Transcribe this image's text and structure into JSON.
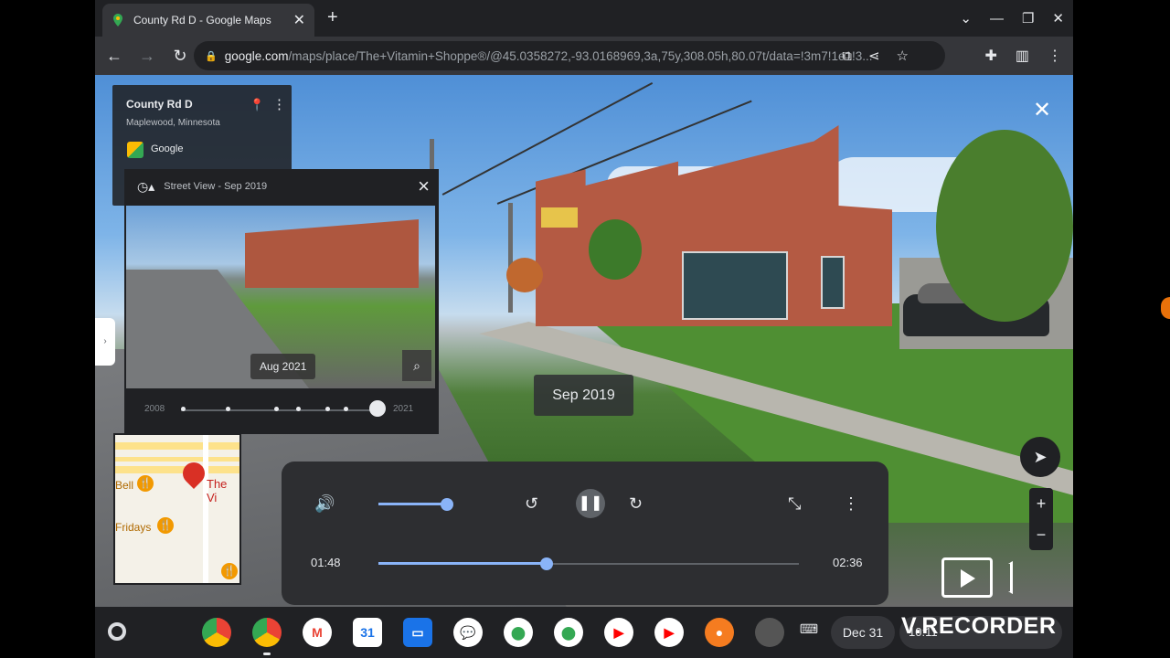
{
  "browser": {
    "tab_title": "County Rd D - Google Maps",
    "tab_close": "✕",
    "new_tab": "+",
    "url_host": "google.com",
    "url_rest": "/maps/place/The+Vitamin+Shoppe®/@45.0358272,-93.0168969,3a,75y,308.05h,80.07t/data=!3m7!1e1!3..."
  },
  "place_card": {
    "name": "County Rd D",
    "location": "Maplewood, Minnesota",
    "provider": "Google"
  },
  "time_travel": {
    "header": "Street View - Sep 2019",
    "date_label": "Aug 2021",
    "year_start": "2008",
    "year_end": "2021",
    "slider_position": 0.97
  },
  "streetview": {
    "current_date": "Sep 2019"
  },
  "minimap": {
    "place_label": "The Vi",
    "label_1": "Bell",
    "label_2": "Fridays"
  },
  "player": {
    "elapsed": "01:48",
    "duration": "02:36",
    "progress": 0.4,
    "volume": 0.66
  },
  "watermark": {
    "text": "V.RECORDER"
  },
  "shelf": {
    "date": "Dec 31",
    "time": "10:11"
  },
  "colors": {
    "accent": "#8ab4f8",
    "panel": "#202124",
    "player_bg": "#2d2e31"
  }
}
